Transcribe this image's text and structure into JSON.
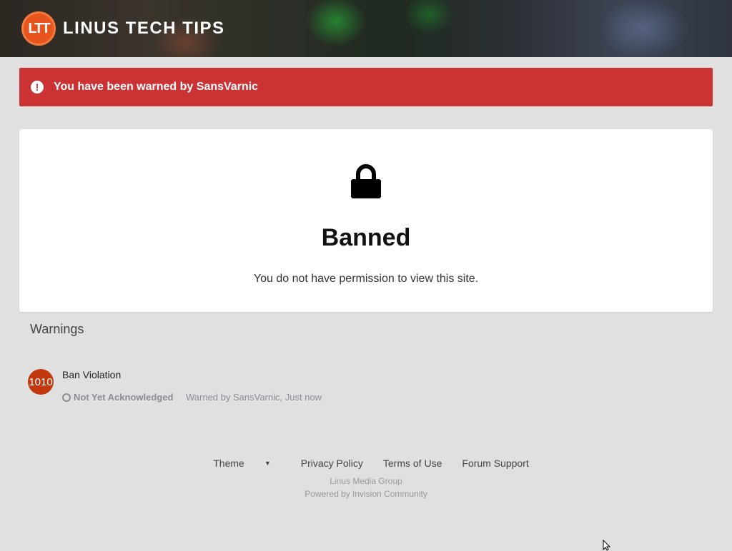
{
  "header": {
    "logo_mark": "LTT",
    "logo_text": "LINUS TECH TIPS",
    "logo_icon": "ltt-logo-icon"
  },
  "alert": {
    "icon": "exclamation-circle-icon",
    "text": "You have been warned by SansVarnic",
    "color": "#cb3234"
  },
  "main": {
    "icon": "lock-icon",
    "title": "Banned",
    "message": "You do not have permission to view this site."
  },
  "warnings": {
    "heading": "Warnings",
    "items": [
      {
        "avatar_text": "1010",
        "avatar_color": "#c1380f",
        "title": "Ban Violation",
        "status_icon": "circle-outline-icon",
        "status": "Not Yet Acknowledged",
        "warned_by": "Warned by SansVarnic, Just now"
      }
    ]
  },
  "footer": {
    "links": {
      "theme": "Theme",
      "privacy": "Privacy Policy",
      "terms": "Terms of Use",
      "support": "Forum Support"
    },
    "company": "Linus Media Group",
    "powered": "Powered by Invision Community"
  }
}
